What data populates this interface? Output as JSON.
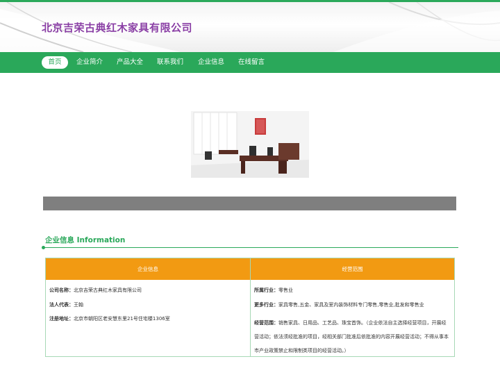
{
  "site": {
    "title": "北京吉荣古典红木家具有限公司"
  },
  "nav": {
    "items": [
      {
        "label": "首页"
      },
      {
        "label": "企业简介"
      },
      {
        "label": "产品大全"
      },
      {
        "label": "联系我们"
      },
      {
        "label": "企业信息"
      },
      {
        "label": "在线留言"
      }
    ]
  },
  "section": {
    "title": "企业信息 Information"
  },
  "info": {
    "left_header": "企业信息",
    "right_header": "经营范围",
    "company_label": "公司名称：",
    "company_value": "北京吉荣古典红木家具有限公司",
    "legal_label": "法人代表：",
    "legal_value": "王翰",
    "address_label": "注册地址：",
    "address_value": "北京市朝阳区老安慧东里21号住宅楼1306室",
    "industry_label": "所属行业：",
    "industry_value": "零售业",
    "more_label": "更多行业：",
    "more_value": "家具零售,五金、家具及室内装饰材料专门零售,零售业,批发和零售业",
    "scope_label": "经营范围：",
    "scope_value": "销售家具、日用品、工艺品、珠宝首饰。（企业依法自主选择经营项目，开展经营活动；依法须经批准的项目，经相关部门批准后依批准的内容开展经营活动；不得从事本市产业政策禁止和限制类项目的经营活动。）"
  },
  "colors": {
    "brand_green": "#2aa85a",
    "title_purple": "#8a3fa5",
    "header_orange": "#f29a12"
  }
}
